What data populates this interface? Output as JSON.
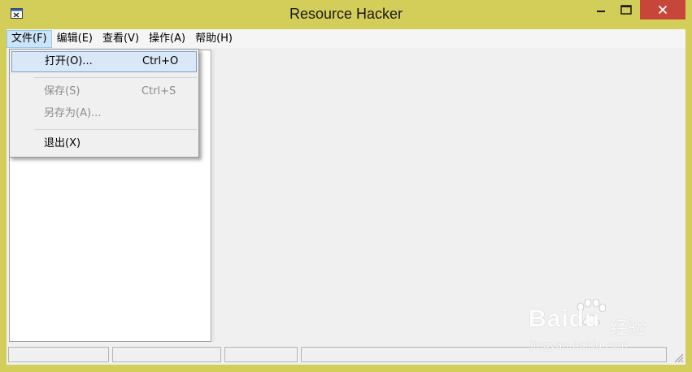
{
  "window": {
    "title": "Resource Hacker",
    "icon": "resource-hacker-app-icon",
    "frame_color": "#d3cd59",
    "close_color": "#c7463a"
  },
  "menubar": {
    "items": [
      {
        "label": "文件(F)",
        "active": true
      },
      {
        "label": "编辑(E)",
        "active": false
      },
      {
        "label": "查看(V)",
        "active": false
      },
      {
        "label": "操作(A)",
        "active": false
      },
      {
        "label": "帮助(H)",
        "active": false
      }
    ]
  },
  "file_menu": {
    "open": {
      "label": "打开(O)...",
      "shortcut": "Ctrl+O",
      "enabled": true,
      "highlighted": true
    },
    "save": {
      "label": "保存(S)",
      "shortcut": "Ctrl+S",
      "enabled": false
    },
    "save_as": {
      "label": "另存为(A)...",
      "enabled": false
    },
    "exit": {
      "label": "退出(X)",
      "enabled": true
    }
  },
  "watermark": {
    "logo": "Baidu",
    "cn_text": "经验",
    "url": "jingyan.baidu.com"
  }
}
